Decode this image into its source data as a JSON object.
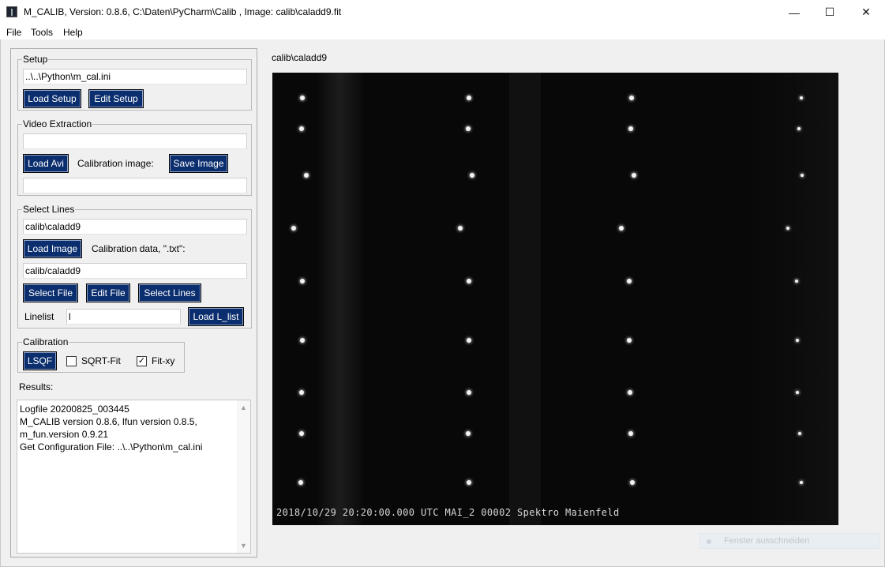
{
  "window": {
    "title": "M_CALIB, Version: 0.8.6, C:\\Daten\\PyCharm\\Calib , Image: calib\\caladd9.fit",
    "minimize_glyph": "—",
    "maximize_glyph": "☐",
    "close_glyph": "✕"
  },
  "menu": [
    "File",
    "Tools",
    "Help"
  ],
  "setup": {
    "legend": "Setup",
    "ini_path": "..\\..\\Python\\m_cal.ini",
    "load_button": "Load Setup",
    "edit_button": "Edit Setup"
  },
  "video": {
    "legend": "Video Extraction",
    "avi_path": "",
    "load_avi_button": "Load Avi",
    "calibration_image_label": "Calibration image:",
    "save_image_button": "Save Image",
    "image_path": ""
  },
  "select_lines": {
    "legend": "Select Lines",
    "image_path": "calib\\caladd9",
    "load_image_button": "Load Image",
    "calibration_data_label": "Calibration data, \".txt\":",
    "data_path": "calib/caladd9",
    "select_file_button": "Select File",
    "edit_file_button": "Edit File",
    "select_lines_button": "Select Lines",
    "linelist_label": "Linelist",
    "linelist_value": "l",
    "load_list_button": "Load L_list"
  },
  "calibration": {
    "legend": "Calibration",
    "lsqf_button": "LSQF",
    "sqrt_fit_label": "SQRT-Fit",
    "sqrt_fit_checked": false,
    "fit_xy_label": "Fit-xy",
    "fit_xy_checked": true,
    "check_glyph": "✓"
  },
  "results": {
    "label": "Results:",
    "lines": [
      "Logfile 20200825_003445",
      "M_CALIB version 0.8.6, lfun version 0.8.5,",
      "m_fun.version 0.9.21",
      "Get Configuration File: ..\\..\\Python\\m_cal.ini"
    ],
    "scroll_up_glyph": "▲",
    "scroll_down_glyph": "▼"
  },
  "image": {
    "title": "calib\\caladd9",
    "overlay": "2018/10/29 20:20:00.000 UTC MAI_2  00002 Spektro Maienfeld"
  },
  "ghost_tooltip": "Fenster ausschneiden"
}
